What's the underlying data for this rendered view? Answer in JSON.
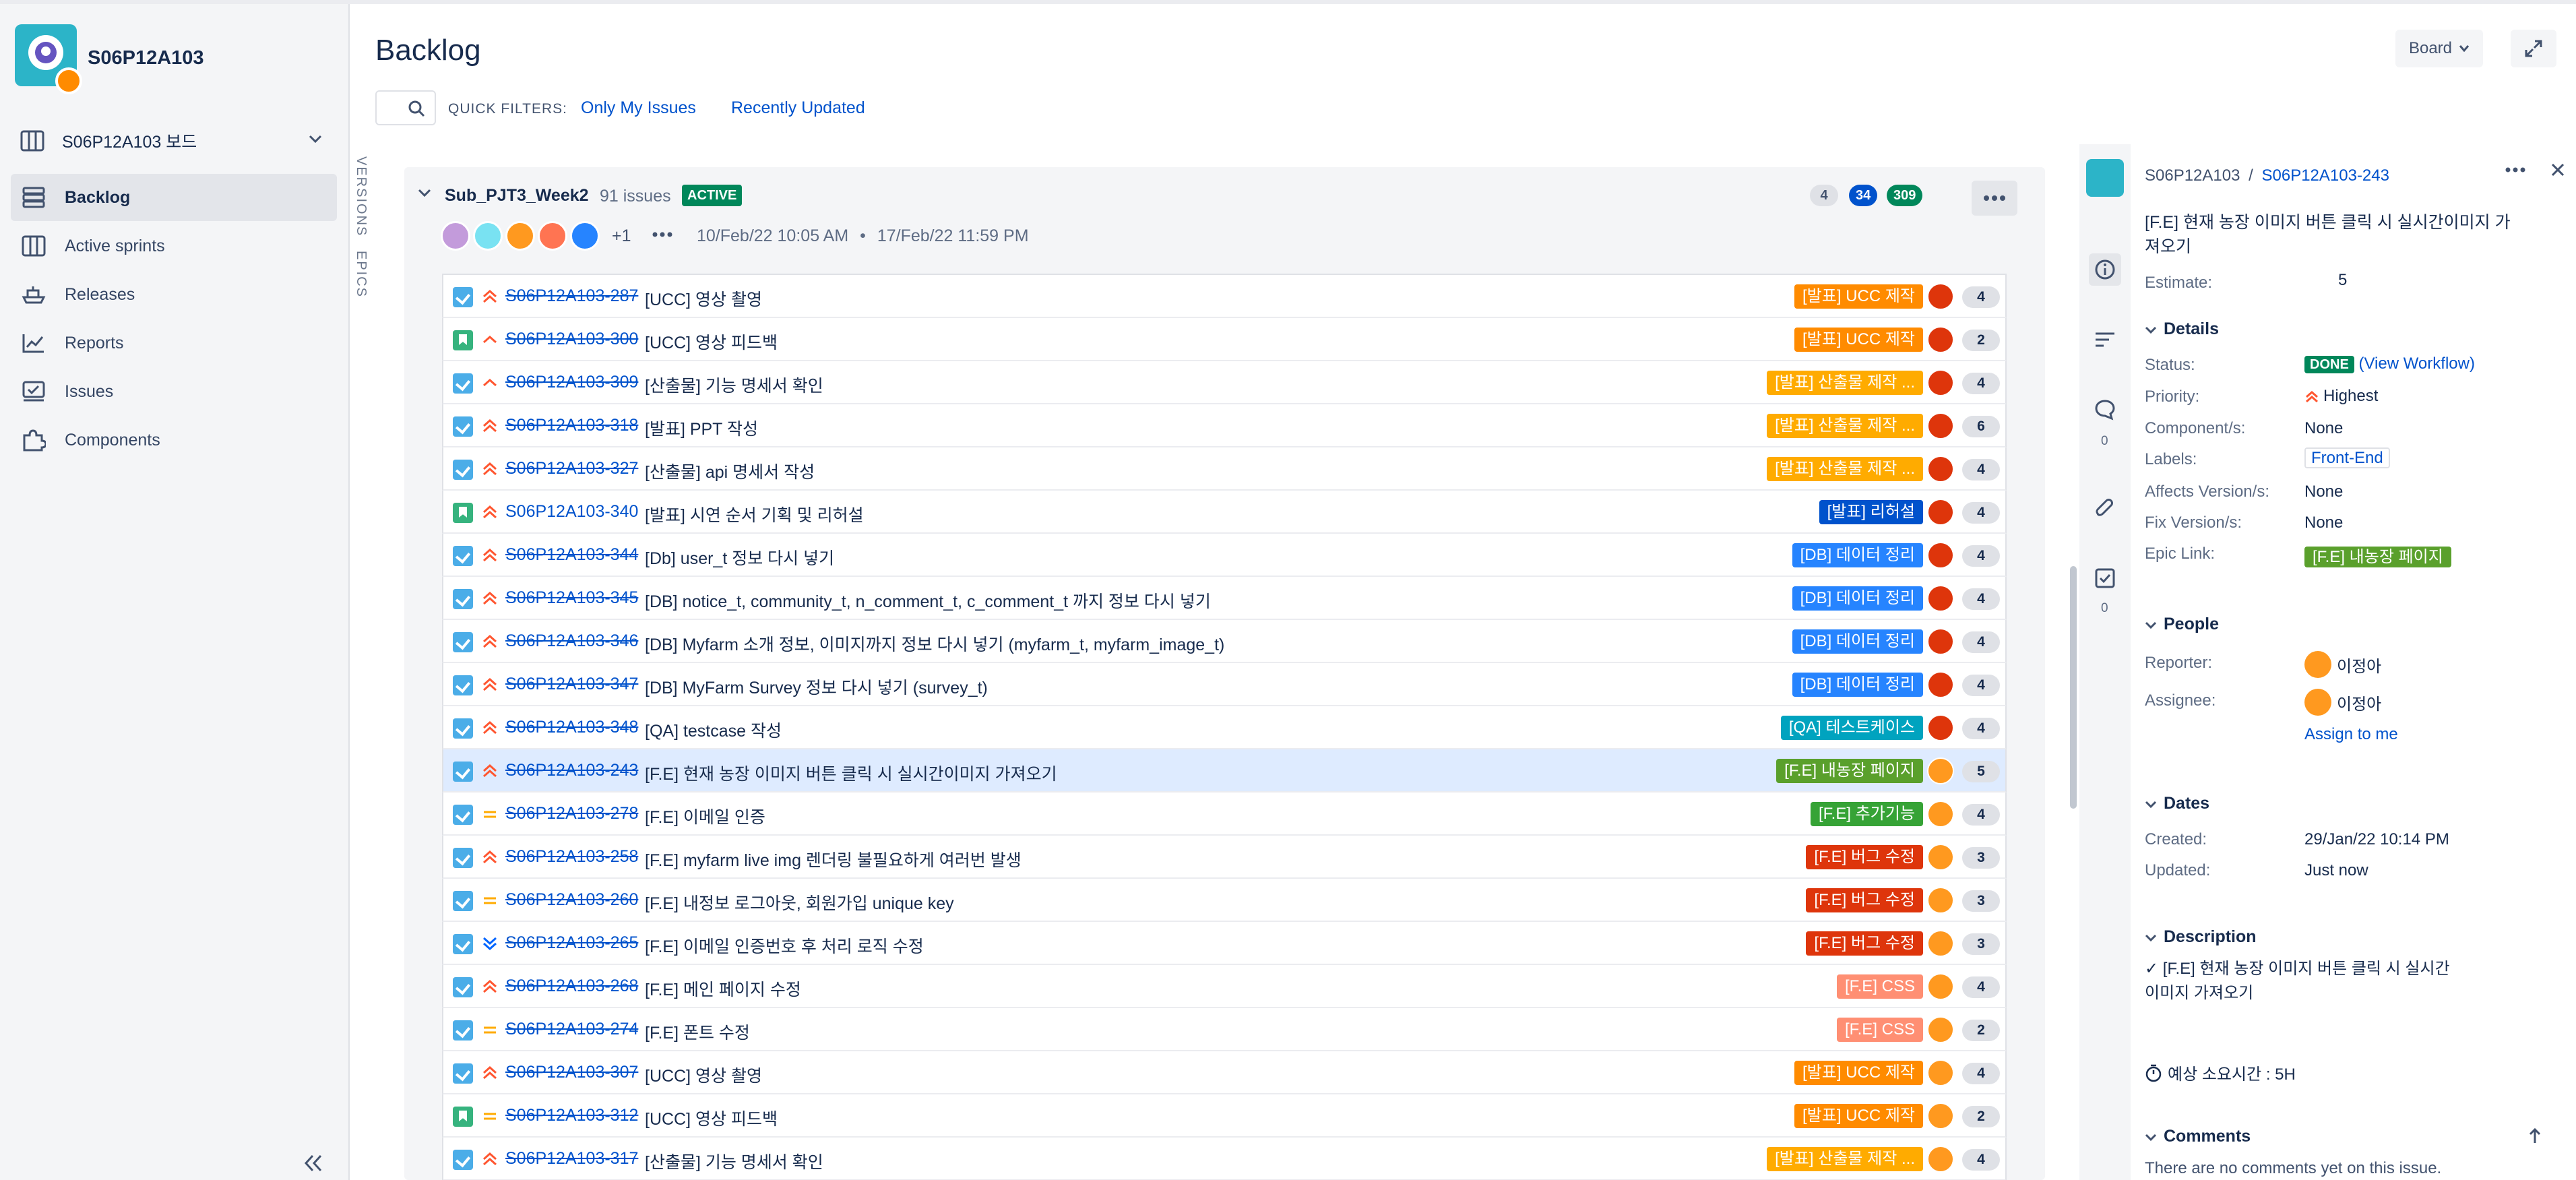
{
  "sidebar": {
    "project_name": "S06P12A103",
    "board_name": "S06P12A103 보드",
    "items": [
      {
        "label": "Backlog",
        "icon": "backlog-icon"
      },
      {
        "label": "Active sprints",
        "icon": "board-columns-icon"
      },
      {
        "label": "Releases",
        "icon": "ship-icon"
      },
      {
        "label": "Reports",
        "icon": "chart-line-icon"
      },
      {
        "label": "Issues",
        "icon": "issues-icon"
      },
      {
        "label": "Components",
        "icon": "puzzle-icon"
      }
    ]
  },
  "header": {
    "title": "Backlog",
    "board_button": "Board",
    "quick_filters_label": "QUICK FILTERS:",
    "filters": [
      "Only My Issues",
      "Recently Updated"
    ],
    "versions_tab": "VERSIONS",
    "epics_tab": "EPICS"
  },
  "sprint": {
    "name": "Sub_PJT3_Week2",
    "issue_count": "91 issues",
    "status": "ACTIVE",
    "counts": {
      "todo": "4",
      "in_progress": "34",
      "done": "309"
    },
    "extra_assignees": "+1",
    "start": "10/Feb/22 10:05 AM",
    "separator": "•",
    "end": "17/Feb/22 11:59 PM"
  },
  "issues": [
    {
      "key": "S06P12A103-287",
      "summary": "[UCC] 영상 촬영",
      "epic": "[발표] UCC 제작",
      "epic_color": "#ff8b00",
      "priority": "highest",
      "type": "task",
      "done": true,
      "estimate": "4",
      "assignee_color": "#de350b"
    },
    {
      "key": "S06P12A103-300",
      "summary": "[UCC] 영상 피드백",
      "epic": "[발표] UCC 제작",
      "epic_color": "#ff8b00",
      "priority": "high",
      "type": "story",
      "done": true,
      "estimate": "2",
      "assignee_color": "#de350b"
    },
    {
      "key": "S06P12A103-309",
      "summary": "[산출물] 기능 명세서 확인",
      "epic": "[발표] 산출물 제작 ...",
      "epic_color": "#ffab00",
      "priority": "high",
      "type": "task",
      "done": true,
      "estimate": "4",
      "assignee_color": "#de350b"
    },
    {
      "key": "S06P12A103-318",
      "summary": "[발표] PPT 작성",
      "epic": "[발표] 산출물 제작 ...",
      "epic_color": "#ffab00",
      "priority": "highest",
      "type": "task",
      "done": true,
      "estimate": "6",
      "assignee_color": "#de350b"
    },
    {
      "key": "S06P12A103-327",
      "summary": "[산출물] api 명세서 작성",
      "epic": "[발표] 산출물 제작 ...",
      "epic_color": "#ffab00",
      "priority": "highest",
      "type": "task",
      "done": true,
      "estimate": "4",
      "assignee_color": "#de350b"
    },
    {
      "key": "S06P12A103-340",
      "summary": "[발표] 시연 순서 기획 및 리허설",
      "epic": "[발표] 리허설",
      "epic_color": "#0052cc",
      "priority": "highest",
      "type": "story",
      "done": false,
      "estimate": "4",
      "assignee_color": "#de350b"
    },
    {
      "key": "S06P12A103-344",
      "summary": "[Db] user_t 정보 다시 넣기",
      "epic": "[DB] 데이터 정리",
      "epic_color": "#2684ff",
      "priority": "highest",
      "type": "task",
      "done": true,
      "estimate": "4",
      "assignee_color": "#de350b"
    },
    {
      "key": "S06P12A103-345",
      "summary": "[DB] notice_t, community_t, n_comment_t, c_comment_t 까지 정보 다시 넣기",
      "epic": "[DB] 데이터 정리",
      "epic_color": "#2684ff",
      "priority": "highest",
      "type": "task",
      "done": true,
      "estimate": "4",
      "assignee_color": "#de350b"
    },
    {
      "key": "S06P12A103-346",
      "summary": "[DB] Myfarm 소개 정보, 이미지까지 정보 다시 넣기 (myfarm_t, myfarm_image_t)",
      "epic": "[DB] 데이터 정리",
      "epic_color": "#2684ff",
      "priority": "highest",
      "type": "task",
      "done": true,
      "estimate": "4",
      "assignee_color": "#de350b"
    },
    {
      "key": "S06P12A103-347",
      "summary": "[DB] MyFarm Survey 정보 다시 넣기 (survey_t)",
      "epic": "[DB] 데이터 정리",
      "epic_color": "#2684ff",
      "priority": "highest",
      "type": "task",
      "done": true,
      "estimate": "4",
      "assignee_color": "#de350b"
    },
    {
      "key": "S06P12A103-348",
      "summary": "[QA] testcase 작성",
      "epic": "[QA] 테스트케이스",
      "epic_color": "#00a3bf",
      "priority": "highest",
      "type": "task",
      "done": true,
      "estimate": "4",
      "assignee_color": "#de350b"
    },
    {
      "key": "S06P12A103-243",
      "summary": "[F.E] 현재 농장 이미지 버튼 클릭 시 실시간이미지 가져오기",
      "epic": "[F.E] 내농장 페이지",
      "epic_color": "#5aa02c",
      "priority": "highest",
      "type": "task",
      "done": true,
      "estimate": "5",
      "assignee_color": "#ff991f",
      "selected": true
    },
    {
      "key": "S06P12A103-278",
      "summary": "[F.E] 이메일 인증",
      "epic": "[F.E] 추가기능",
      "epic_color": "#36a336",
      "priority": "medium",
      "type": "task",
      "done": true,
      "estimate": "4",
      "assignee_color": "#ff991f"
    },
    {
      "key": "S06P12A103-258",
      "summary": "[F.E] myfarm live img 렌더링 불필요하게 여러번 발생",
      "epic": "[F.E] 버그 수정",
      "epic_color": "#de350b",
      "priority": "highest",
      "type": "task",
      "done": true,
      "estimate": "3",
      "assignee_color": "#ff991f"
    },
    {
      "key": "S06P12A103-260",
      "summary": "[F.E] 내정보 로그아웃, 회원가입 unique key",
      "epic": "[F.E] 버그 수정",
      "epic_color": "#de350b",
      "priority": "medium",
      "type": "task",
      "done": true,
      "estimate": "3",
      "assignee_color": "#ff991f"
    },
    {
      "key": "S06P12A103-265",
      "summary": "[F.E] 이메일 인증번호 후 처리 로직 수정",
      "epic": "[F.E] 버그 수정",
      "epic_color": "#de350b",
      "priority": "lowest",
      "type": "task",
      "done": true,
      "estimate": "3",
      "assignee_color": "#ff991f"
    },
    {
      "key": "S06P12A103-268",
      "summary": "[F.E] 메인 페이지 수정",
      "epic": "[F.E] CSS",
      "epic_color": "#ff8f73",
      "priority": "highest",
      "type": "task",
      "done": true,
      "estimate": "4",
      "assignee_color": "#ff991f"
    },
    {
      "key": "S06P12A103-274",
      "summary": "[F.E] 폰트 수정",
      "epic": "[F.E] CSS",
      "epic_color": "#ff8f73",
      "priority": "medium",
      "type": "task",
      "done": true,
      "estimate": "2",
      "assignee_color": "#ff991f"
    },
    {
      "key": "S06P12A103-307",
      "summary": "[UCC] 영상 촬영",
      "epic": "[발표] UCC 제작",
      "epic_color": "#ff8b00",
      "priority": "highest",
      "type": "task",
      "done": true,
      "estimate": "4",
      "assignee_color": "#ff991f"
    },
    {
      "key": "S06P12A103-312",
      "summary": "[UCC] 영상 피드백",
      "epic": "[발표] UCC 제작",
      "epic_color": "#ff8b00",
      "priority": "medium",
      "type": "story",
      "done": true,
      "estimate": "2",
      "assignee_color": "#ff991f"
    },
    {
      "key": "S06P12A103-317",
      "summary": "[산출물] 기능 명세서 확인",
      "epic": "[발표] 산출물 제작 ...",
      "epic_color": "#ffab00",
      "priority": "highest",
      "type": "task",
      "done": true,
      "estimate": "4",
      "assignee_color": "#ff991f"
    }
  ],
  "detail": {
    "project": "S06P12A103",
    "crumb_sep": "/",
    "key": "S06P12A103-243",
    "title": "[F.E] 현재 농장 이미지 버튼 클릭 시 실시간이미지 가져오기",
    "estimate_label": "Estimate:",
    "estimate": "5",
    "details_heading": "Details",
    "status_label": "Status:",
    "status": "DONE",
    "view_workflow": "(View Workflow)",
    "priority_label": "Priority:",
    "priority": "Highest",
    "components_label": "Component/s:",
    "components": "None",
    "labels_label": "Labels:",
    "labels": "Front-End",
    "affects_label": "Affects Version/s:",
    "affects": "None",
    "fix_label": "Fix Version/s:",
    "fix": "None",
    "epic_label": "Epic Link:",
    "epic": "[F.E] 내농장 페이지",
    "people_heading": "People",
    "reporter_label": "Reporter:",
    "reporter": "이정아",
    "assignee_label": "Assignee:",
    "assignee": "이정아",
    "assign_to_me": "Assign to me",
    "dates_heading": "Dates",
    "created_label": "Created:",
    "created": "29/Jan/22 10:14 PM",
    "updated_label": "Updated:",
    "updated": "Just now",
    "description_heading": "Description",
    "description_line1": "✓ [F.E] 현재 농장 이미지 버튼 클릭 시 실시간",
    "description_line2": "이미지 가져오기",
    "time_estimate": "예상 소요시간 : 5H",
    "comments_heading": "Comments",
    "no_comments": "There are no comments yet on this issue.",
    "comment_count": "0",
    "checklist_count": "0"
  }
}
